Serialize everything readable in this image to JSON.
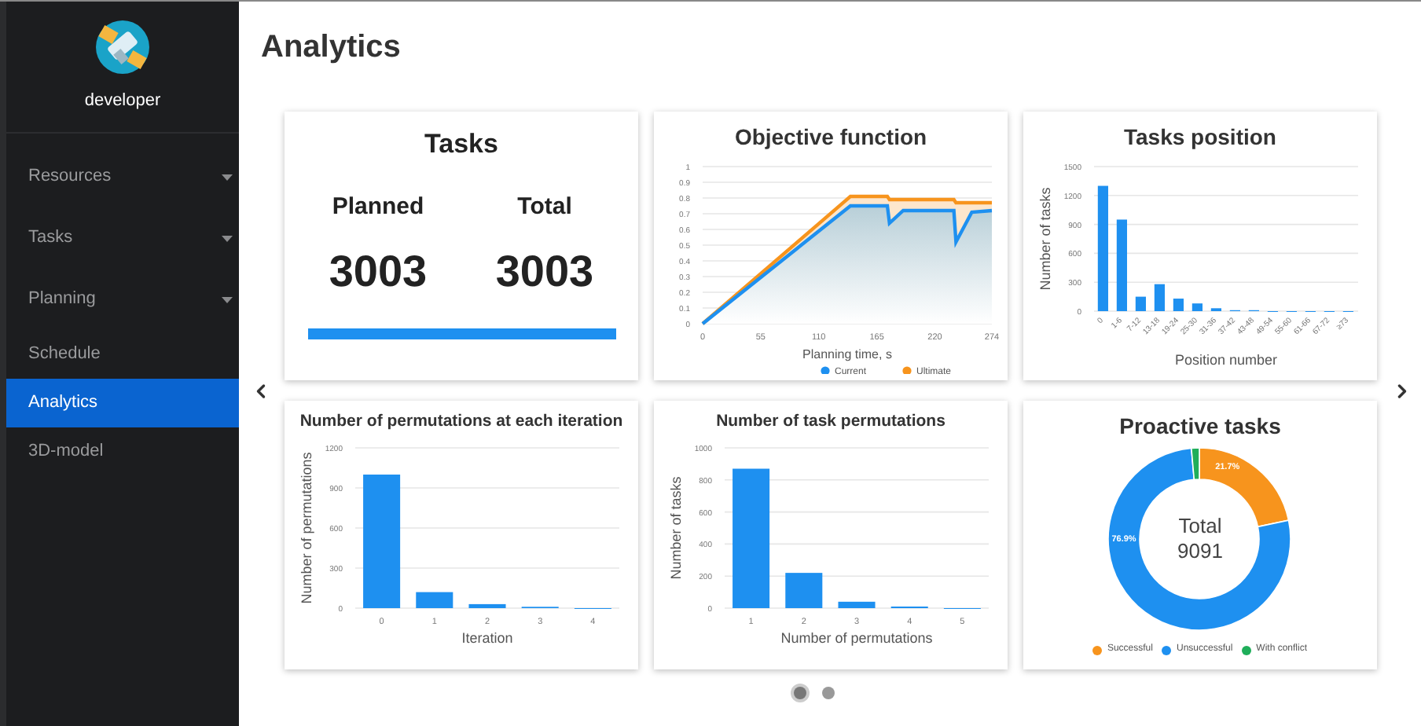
{
  "sidebar": {
    "user": "developer",
    "items": [
      {
        "label": "Resources",
        "has_submenu": true,
        "selected": false
      },
      {
        "label": "Tasks",
        "has_submenu": true,
        "selected": false
      },
      {
        "label": "Planning",
        "has_submenu": true,
        "selected": false
      },
      {
        "label": "Schedule",
        "has_submenu": false,
        "selected": false
      },
      {
        "label": "Analytics",
        "has_submenu": false,
        "selected": true
      },
      {
        "label": "3D-model",
        "has_submenu": false,
        "selected": false
      }
    ]
  },
  "page": {
    "title": "Analytics"
  },
  "cards": [
    {
      "kind": "summary",
      "title": "Tasks",
      "stats": [
        {
          "label": "Planned",
          "value": "3003"
        },
        {
          "label": "Total",
          "value": "3003"
        }
      ],
      "progress": {
        "level": 1
      }
    },
    {
      "chart_data": {
        "type": "area",
        "title": "Objective function",
        "xlabel": "Planning time, s",
        "xlim": [
          0,
          274
        ],
        "ylim": [
          0,
          1
        ],
        "xticks": [
          0,
          55,
          110,
          165,
          220,
          274
        ],
        "yticks": [
          0,
          0.1,
          0.2,
          0.3,
          0.4,
          0.5,
          0.6,
          0.7,
          0.8,
          0.9,
          1
        ],
        "grid": true,
        "legend": "bottom",
        "x": [
          0,
          140,
          175,
          177,
          190,
          238,
          240,
          255,
          274
        ],
        "series": [
          {
            "name": "Current",
            "color": "#1e90f0",
            "values": [
              0,
              0.75,
              0.75,
              0.64,
              0.72,
              0.72,
              0.52,
              0.71,
              0.72
            ]
          },
          {
            "name": "Ultimate",
            "color": "#f7941d",
            "values": [
              0,
              0.81,
              0.81,
              0.79,
              0.79,
              0.79,
              0.77,
              0.77,
              0.77
            ]
          }
        ]
      }
    },
    {
      "rotate_labels": true,
      "chart_data": {
        "type": "bar",
        "title": "Tasks position",
        "xlabel": "Position number",
        "ylabel": "Number of tasks",
        "ylim": [
          0,
          1500
        ],
        "yticks": [
          0,
          300,
          600,
          900,
          1200,
          1500
        ],
        "grid": true,
        "categories": [
          "0",
          "1-6",
          "7-12",
          "13-18",
          "19-24",
          "25-30",
          "31-36",
          "37-42",
          "43-48",
          "49-54",
          "55-60",
          "61-66",
          "67-72",
          "≥73"
        ],
        "series": [
          {
            "color": "#1e90f0",
            "values": [
              1300,
              950,
              150,
              280,
              130,
              80,
              30,
              10,
              10,
              0,
              0,
              0,
              0,
              0
            ]
          }
        ]
      }
    },
    {
      "rotate_labels": false,
      "chart_data": {
        "type": "bar",
        "title": "Number of permutations at each iteration",
        "xlabel": "Iteration",
        "ylabel": "Number of permutations",
        "ylim": [
          0,
          1200
        ],
        "yticks": [
          0,
          300,
          600,
          900,
          1200
        ],
        "grid": true,
        "categories": [
          "0",
          "1",
          "2",
          "3",
          "4"
        ],
        "series": [
          {
            "color": "#1e90f0",
            "values": [
              1000,
              120,
              30,
              10,
              0
            ]
          }
        ]
      }
    },
    {
      "rotate_labels": false,
      "chart_data": {
        "type": "bar",
        "title": "Number of task permutations",
        "xlabel": "Number of permutations",
        "ylabel": "Number of tasks",
        "ylim": [
          0,
          1000
        ],
        "yticks": [
          0,
          200,
          400,
          600,
          800,
          1000
        ],
        "grid": true,
        "categories": [
          "1",
          "2",
          "3",
          "4",
          "5"
        ],
        "series": [
          {
            "color": "#1e90f0",
            "values": [
              870,
              220,
              40,
              10,
              0
            ]
          }
        ]
      }
    },
    {
      "total_label": "Total",
      "total_value": "9091",
      "legend": [
        {
          "label": "Successful",
          "color": "#f7941d"
        },
        {
          "label": "Unsuccessful",
          "color": "#1e90f0"
        },
        {
          "label": "With conflict",
          "color": "#1fae5a"
        }
      ],
      "chart_data": {
        "type": "donut",
        "title": "Proactive tasks",
        "values": [
          21.7,
          76.9,
          1.4
        ],
        "value_labels": [
          "21.7%",
          "76.9%",
          null
        ]
      }
    }
  ],
  "pager": [
    {
      "selected": true
    },
    {
      "selected": false
    }
  ]
}
